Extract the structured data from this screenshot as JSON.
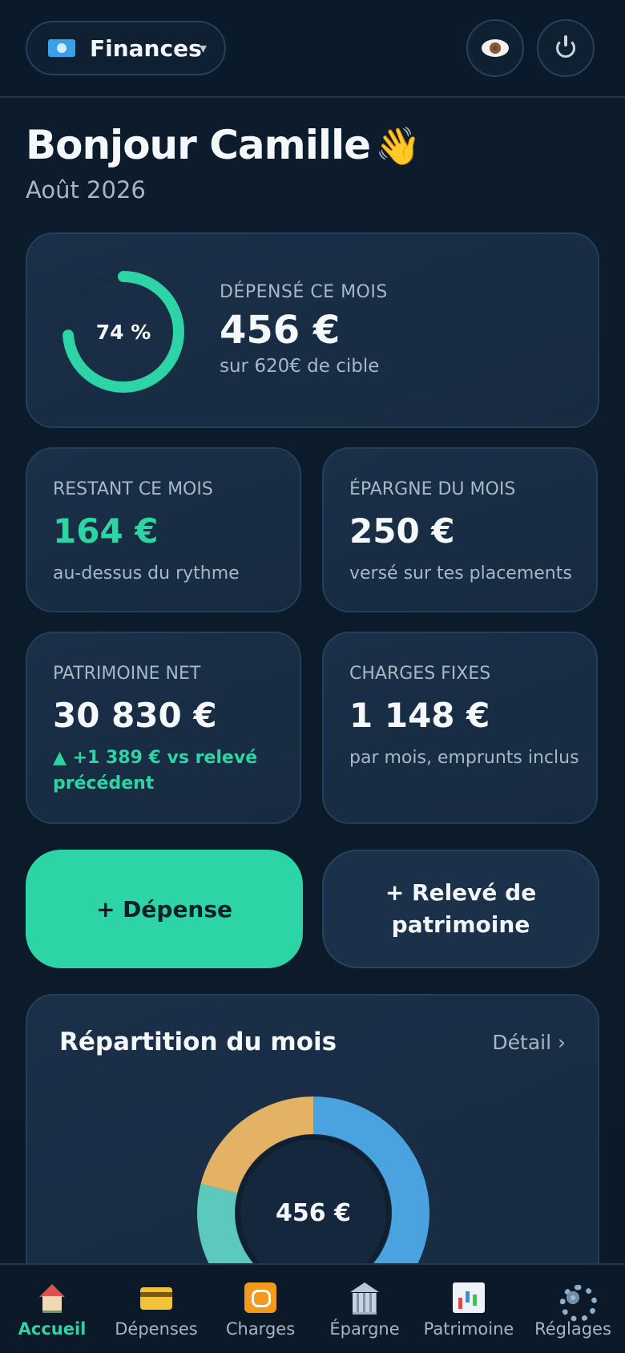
{
  "header": {
    "switcher_label": "Finances",
    "switcher_chevron": "▾",
    "switcher_icon": "money-icon"
  },
  "greeting": {
    "title": "Bonjour Camille",
    "wave": "👋",
    "date": "Août 2026"
  },
  "spent": {
    "percent_label": "74 %",
    "percent_value": 0.74,
    "caption": "DÉPENSÉ CE MOIS",
    "amount": "456 €",
    "target": "sur 620€ de cible"
  },
  "cards": {
    "remaining": {
      "caption": "RESTANT CE MOIS",
      "amount": "164 €",
      "sub": "au-dessus du rythme"
    },
    "savings": {
      "caption": "ÉPARGNE DU MOIS",
      "amount": "250 €",
      "sub": "versé sur tes placements"
    },
    "networth": {
      "caption": "PATRIMOINE NET",
      "amount": "30 830 €",
      "sub": "▲ +1 389 € vs relevé précédent"
    },
    "fixed": {
      "caption": "CHARGES FIXES",
      "amount": "1 148 €",
      "sub": "par mois, emprunts inclus"
    }
  },
  "actions": {
    "add_expense": "+ Dépense",
    "add_statement": "+ Relevé de patrimoine"
  },
  "breakdown": {
    "title": "Répartition du mois",
    "link": "Détail ›",
    "center_label": "456 €",
    "segments": [
      {
        "fraction": 0.5,
        "color": "#4aa3de"
      },
      {
        "fraction": 0.29,
        "color": "#5cc9bd"
      },
      {
        "fraction": 0.21,
        "color": "#e4b264"
      }
    ]
  },
  "nav": {
    "items": [
      {
        "label": "Accueil",
        "icon": "house-icon"
      },
      {
        "label": "Dépenses",
        "icon": "credit-card-icon"
      },
      {
        "label": "Charges",
        "icon": "repeat-icon"
      },
      {
        "label": "Épargne",
        "icon": "bank-icon"
      },
      {
        "label": "Patrimoine",
        "icon": "bar-chart-icon"
      },
      {
        "label": "Réglages",
        "icon": "gear-icon"
      }
    ],
    "active_index": 0
  },
  "colors": {
    "accent": "#2dd4a5",
    "background": "#0c1b2b",
    "card": "#1a3048"
  }
}
